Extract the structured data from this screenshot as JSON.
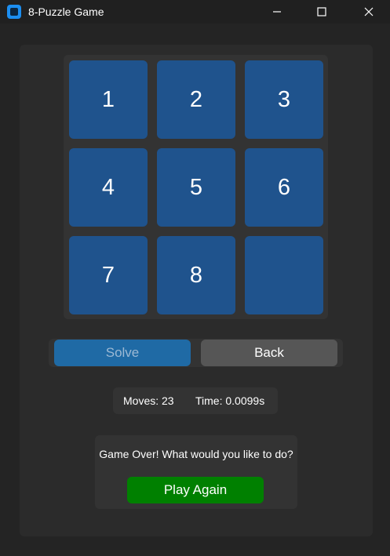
{
  "window": {
    "title": "8-Puzzle Game",
    "app_icon": "app-icon",
    "controls": [
      "minimize-icon",
      "maximize-icon",
      "close-icon"
    ]
  },
  "board": {
    "tiles": [
      "1",
      "2",
      "3",
      "4",
      "5",
      "6",
      "7",
      "8",
      ""
    ]
  },
  "actions": {
    "solve_label": "Solve",
    "back_label": "Back"
  },
  "stats": {
    "moves_text": "Moves: 23",
    "time_text": "Time: 0.0099s"
  },
  "game_over": {
    "message": "Game Over! What would you like to do?",
    "play_again_label": "Play Again"
  },
  "colors": {
    "tile": "#1f538d",
    "solve": "#1f6aa5",
    "back": "#565656",
    "play_again": "#008000"
  }
}
